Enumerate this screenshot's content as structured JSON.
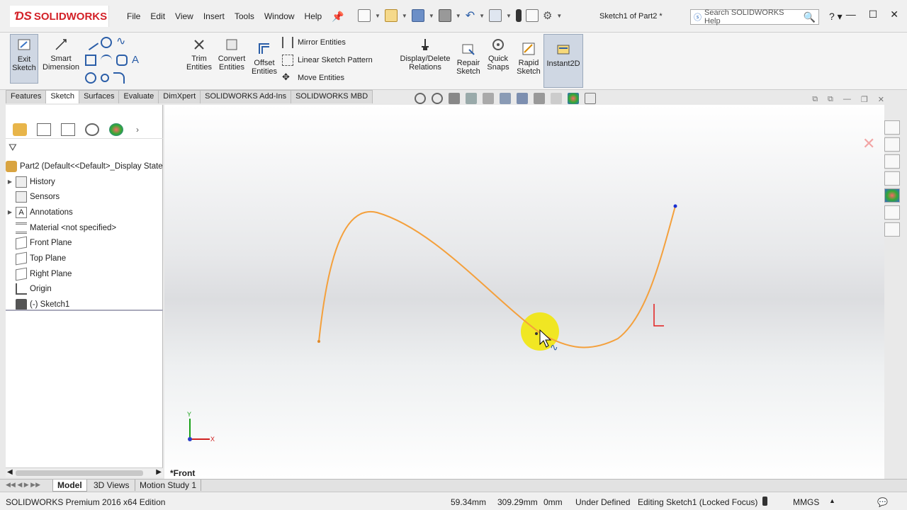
{
  "app": {
    "brand": "SOLIDWORKS",
    "title": "Sketch1 of Part2 *",
    "menu": [
      "File",
      "Edit",
      "View",
      "Insert",
      "Tools",
      "Window",
      "Help"
    ],
    "search_placeholder": "Search SOLIDWORKS Help"
  },
  "ribbon": {
    "exit_sketch": "Exit Sketch",
    "smart_dimension": "Smart Dimension",
    "trim_entities": "Trim Entities",
    "convert_entities": "Convert Entities",
    "offset_entities": "Offset Entities",
    "mirror_entities": "Mirror Entities",
    "linear_sketch_pattern": "Linear Sketch Pattern",
    "move_entities": "Move Entities",
    "display_delete_relations": "Display/Delete Relations",
    "repair_sketch": "Repair Sketch",
    "quick_snaps": "Quick Snaps",
    "rapid_sketch": "Rapid Sketch",
    "instant2d": "Instant2D"
  },
  "tabs": [
    "Features",
    "Sketch",
    "Surfaces",
    "Evaluate",
    "DimXpert",
    "SOLIDWORKS Add-Ins",
    "SOLIDWORKS MBD"
  ],
  "tree": {
    "root": "Part2  (Default<<Default>_Display State",
    "items": [
      "History",
      "Sensors",
      "Annotations",
      "Material <not specified>",
      "Front Plane",
      "Top Plane",
      "Right Plane",
      "Origin",
      "(-) Sketch1"
    ]
  },
  "canvas": {
    "view_label": "*Front",
    "axis_x": "X",
    "axis_y": "Y",
    "spline_color": "#f4a03c",
    "highlight_color": "#f2e600"
  },
  "bottom_tabs": [
    "Model",
    "3D Views",
    "Motion Study 1"
  ],
  "status": {
    "edition": "SOLIDWORKS Premium 2016 x64 Edition",
    "x": "59.34mm",
    "y": "309.29mm",
    "z": "0mm",
    "state": "Under Defined",
    "editing": "Editing Sketch1 (Locked Focus)",
    "units": "MMGS"
  }
}
